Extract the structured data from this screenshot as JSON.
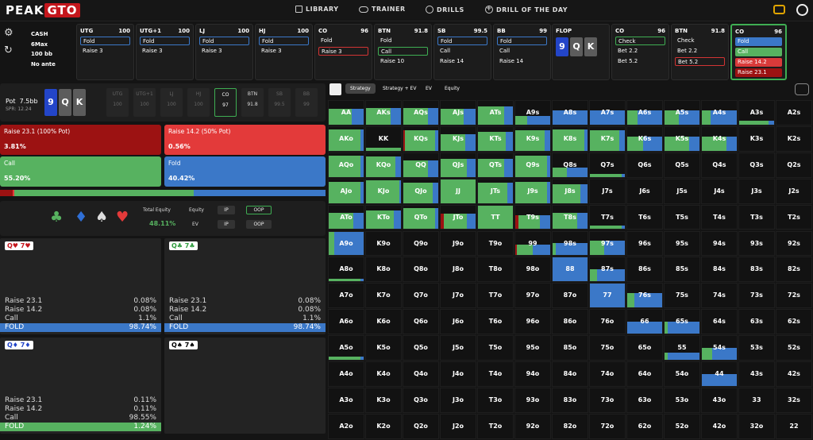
{
  "brand": {
    "word1": "PEAK",
    "word2": "GTO"
  },
  "nav": [
    {
      "icon": "book-icon",
      "label": "LIBRARY"
    },
    {
      "icon": "gamepad-icon",
      "label": "TRAINER"
    },
    {
      "icon": "target-icon",
      "label": "DRILLS"
    },
    {
      "icon": "plus-circle-icon",
      "label": "DRILL OF THE DAY"
    }
  ],
  "game": {
    "cash": "CASH",
    "max": "6Max",
    "stack": "100 bb",
    "ante": "No ante"
  },
  "seats": [
    {
      "name": "UTG",
      "stack": "100",
      "options": [
        {
          "t": "Fold",
          "s": "o-blue"
        },
        {
          "t": "Raise 3",
          "s": ""
        }
      ]
    },
    {
      "name": "UTG+1",
      "stack": "100",
      "options": [
        {
          "t": "Fold",
          "s": "o-blue"
        },
        {
          "t": "Raise 3",
          "s": ""
        }
      ]
    },
    {
      "name": "LJ",
      "stack": "100",
      "options": [
        {
          "t": "Fold",
          "s": "o-blue"
        },
        {
          "t": "Raise 3",
          "s": ""
        }
      ]
    },
    {
      "name": "HJ",
      "stack": "100",
      "options": [
        {
          "t": "Fold",
          "s": "o-blue"
        },
        {
          "t": "Raise 3",
          "s": ""
        }
      ]
    },
    {
      "name": "CO",
      "stack": "96",
      "options": [
        {
          "t": "Fold",
          "s": ""
        },
        {
          "t": "Raise 3",
          "s": "o-red"
        }
      ]
    },
    {
      "name": "BTN",
      "stack": "91.8",
      "options": [
        {
          "t": "Fold",
          "s": ""
        },
        {
          "t": "Call",
          "s": "o-green"
        },
        {
          "t": "Raise 10",
          "s": ""
        }
      ]
    },
    {
      "name": "SB",
      "stack": "99.5",
      "options": [
        {
          "t": "Fold",
          "s": "o-blue"
        },
        {
          "t": "Call",
          "s": ""
        },
        {
          "t": "Raise 14",
          "s": ""
        }
      ]
    },
    {
      "name": "BB",
      "stack": "99",
      "options": [
        {
          "t": "Fold",
          "s": "o-blue"
        },
        {
          "t": "Call",
          "s": ""
        },
        {
          "t": "Raise 14",
          "s": ""
        }
      ]
    }
  ],
  "flop": {
    "label": "FLOP",
    "cards": [
      "9",
      "Q",
      "K"
    ]
  },
  "post_seats": [
    {
      "name": "CO",
      "stack": "96",
      "options": [
        {
          "t": "Check",
          "s": "o-green"
        },
        {
          "t": "Bet 2.2",
          "s": ""
        },
        {
          "t": "Bet 5.2",
          "s": ""
        }
      ]
    },
    {
      "name": "BTN",
      "stack": "91.8",
      "options": [
        {
          "t": "Check",
          "s": ""
        },
        {
          "t": "Bet 2.2",
          "s": ""
        },
        {
          "t": "Bet 5.2",
          "s": "o-red"
        }
      ]
    },
    {
      "name": "CO",
      "stack": "96",
      "options": [
        {
          "t": "Fold",
          "s": "f-blue"
        },
        {
          "t": "Call",
          "s": "f-green"
        },
        {
          "t": "Raise 14.2",
          "s": "f-red"
        },
        {
          "t": "Raise 23.1",
          "s": "f-dred"
        }
      ]
    }
  ],
  "pot": {
    "label": "Pot",
    "value": "7.5bb",
    "spr": "SPR: 12.24",
    "board": [
      "9",
      "Q",
      "K"
    ]
  },
  "mini_seats": [
    {
      "n": "UTG",
      "v": "100"
    },
    {
      "n": "UTG+1",
      "v": "100"
    },
    {
      "n": "LJ",
      "v": "100"
    },
    {
      "n": "HJ",
      "v": "100"
    },
    {
      "n": "CO",
      "v": "97"
    },
    {
      "n": "BTN",
      "v": "91.8"
    },
    {
      "n": "SB",
      "v": "99.5"
    },
    {
      "n": "BB",
      "v": "99"
    }
  ],
  "actions": [
    {
      "label": "Raise 23.1 (100% Pot)",
      "pct": "3.81%",
      "color": "#9c1212"
    },
    {
      "label": "Raise 14.2 (50% Pot)",
      "pct": "0.56%",
      "color": "#e33a3a"
    },
    {
      "label": "Call",
      "pct": "55.20%",
      "color": "#57b260"
    },
    {
      "label": "Fold",
      "pct": "40.42%",
      "color": "#3b78c8"
    }
  ],
  "equity": {
    "total_label": "Total Equity",
    "total": "48.11%",
    "equity_label": "Equity",
    "ev_label": "EV",
    "ip": "IP",
    "oop": "OOP"
  },
  "tiles": [
    {
      "hand": "Q♥ 7♥",
      "rows": [
        [
          "Raise 23.1",
          "0.08%"
        ],
        [
          "Raise 14.2",
          "0.08%"
        ],
        [
          "Call",
          "1.1%"
        ]
      ],
      "fold": [
        "FOLD",
        "98.74%"
      ],
      "fold_color": "#3b78c8"
    },
    {
      "hand": "Q♣ 7♣",
      "rows": [
        [
          "Raise 23.1",
          "0.08%"
        ],
        [
          "Raise 14.2",
          "0.08%"
        ],
        [
          "Call",
          "1.1%"
        ]
      ],
      "fold": [
        "FOLD",
        "98.74%"
      ],
      "fold_color": "#3b78c8"
    },
    {
      "hand": "Q♦ 7♦",
      "rows": [
        [
          "Raise 23.1",
          "0.11%"
        ],
        [
          "Raise 14.2",
          "0.11%"
        ],
        [
          "Call",
          "98.55%"
        ]
      ],
      "fold": [
        "FOLD",
        "1.24%"
      ],
      "fold_color": "#57b260"
    },
    {
      "hand": "Q♠ 7♠",
      "rows": [],
      "fold": [
        "",
        ""
      ],
      "fold_color": ""
    }
  ],
  "tabs": [
    "Strategy",
    "Strategy + EV",
    "EV",
    "Equity"
  ],
  "colors": {
    "fold": "#3b78c8",
    "call": "#57b260",
    "raise_small": "#e33a3a",
    "raise_big": "#9c1212",
    "accent": "#3fae53"
  },
  "ranks": [
    "A",
    "K",
    "Q",
    "J",
    "T",
    "9",
    "8",
    "7",
    "6",
    "5",
    "4",
    "3",
    "2"
  ],
  "matrix_fill": {
    "AA": [
      0,
      0.35,
      0.65
    ],
    "AKs": [
      0,
      0.3,
      0.7
    ],
    "AQs": [
      0,
      0.3,
      0.7
    ],
    "AJs": [
      0,
      0.35,
      0.65
    ],
    "ATs": [
      0,
      0.25,
      0.75
    ],
    "A9s": [
      0,
      0.65,
      0.35
    ],
    "A8s": [
      0,
      1,
      0.6
    ],
    "A7s": [
      0,
      1,
      0.6
    ],
    "A6s": [
      0,
      0.7,
      0.6
    ],
    "A5s": [
      0,
      0.6,
      0.6
    ],
    "A4s": [
      0,
      0.75,
      0.6
    ],
    "A3s": [
      0,
      0.15,
      0.15
    ],
    "AKo": [
      0,
      0.1,
      0.9
    ],
    "KK": [
      0,
      0,
      0
    ],
    "KQs": [
      0.05,
      0.1,
      0.85
    ],
    "KJs": [
      0,
      0.3,
      0.7
    ],
    "KTs": [
      0,
      0.2,
      0.8
    ],
    "K9s": [
      0,
      0.15,
      0.85
    ],
    "K8s": [
      0,
      0.1,
      0.9
    ],
    "K7s": [
      0,
      0.15,
      0.85
    ],
    "K6s": [
      0,
      0.55,
      0.6
    ],
    "K5s": [
      0,
      0.3,
      0.6
    ],
    "K4s": [
      0,
      0.3,
      0.6
    ],
    "AQo": [
      0,
      0.1,
      0.9
    ],
    "KQo": [
      0,
      0.15,
      0.85
    ],
    "QQ": [
      0,
      0.3,
      0.7
    ],
    "QJs": [
      0,
      0.25,
      0.75
    ],
    "QTs": [
      0,
      0.25,
      0.75
    ],
    "Q9s": [
      0,
      0.1,
      0.9
    ],
    "Q8s": [
      0,
      0.6,
      0.4
    ],
    "Q7s": [
      0,
      0.1,
      0.1
    ],
    "AJo": [
      0,
      0.1,
      0.9
    ],
    "KJo": [
      0,
      0.05,
      0.95
    ],
    "QJo": [
      0,
      0.15,
      0.85
    ],
    "JJ": [
      0,
      0,
      1
    ],
    "JTs": [
      0,
      0.15,
      0.85
    ],
    "J9s": [
      0,
      0.1,
      0.9
    ],
    "J8s": [
      0,
      0.2,
      0.8
    ],
    "ATo": [
      0,
      0.3,
      0.7
    ],
    "KTo": [
      0,
      0.2,
      0.8
    ],
    "QTo": [
      0,
      0.1,
      0.9
    ],
    "JTo": [
      0.1,
      0.25,
      0.65
    ],
    "TT": [
      0,
      0,
      1
    ],
    "T9s": [
      0.1,
      0.3,
      0.6
    ],
    "T8s": [
      0,
      0.3,
      0.7
    ],
    "T7s": [
      0,
      0.1,
      0.15
    ],
    "A9o": [
      0,
      0.85,
      1
    ],
    "99": [
      0.05,
      0.5,
      0.45
    ],
    "98s": [
      0,
      0.9,
      0.5
    ],
    "97s": [
      0,
      0.6,
      0.6
    ],
    "88": [
      0,
      1,
      1
    ],
    "87s": [
      0,
      0.8,
      0.5
    ],
    "77": [
      0,
      1,
      1
    ],
    "76s": [
      0,
      0.8,
      0.6
    ],
    "66": [
      0,
      1,
      0.5
    ],
    "65s": [
      0,
      0.9,
      0.5
    ],
    "55": [
      0,
      0.9,
      0.3
    ],
    "54s": [
      0,
      0.7,
      0.5
    ],
    "44": [
      0,
      1,
      0.5
    ],
    "A8o": [
      0,
      0.1,
      0.1
    ],
    "A5o": [
      0,
      0.1,
      0.1
    ]
  }
}
